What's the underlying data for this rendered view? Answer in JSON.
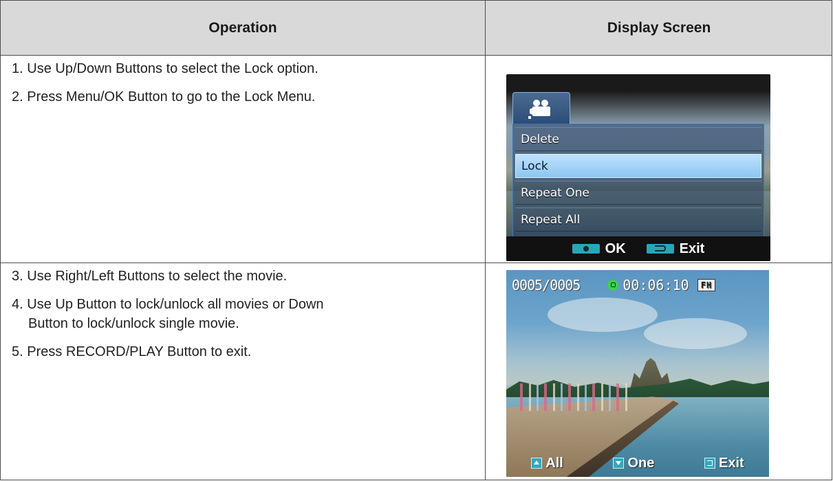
{
  "table": {
    "headers": {
      "operation": "Operation",
      "display": "Display Screen"
    },
    "rows": [
      {
        "steps": [
          {
            "num": "1.",
            "text": "Use Up/Down Buttons to select the Lock option."
          },
          {
            "num": "2.",
            "text": "Press Menu/OK Button to go to the Lock Menu."
          }
        ],
        "screen": {
          "type": "menu",
          "tab_icon": "movie-camera-icon",
          "items": [
            "Delete",
            "Lock",
            "Repeat One",
            "Repeat  All"
          ],
          "selected_index": 1,
          "footer": {
            "ok_label": "OK",
            "exit_label": "Exit"
          }
        }
      },
      {
        "steps": [
          {
            "num": "3.",
            "text": "Use Right/Left Buttons to select the movie."
          },
          {
            "num": "4.",
            "text": "Use Up Button to lock/unlock all movies or Down",
            "cont": "Button to lock/unlock single movie."
          },
          {
            "num": "5.",
            "text": "Press RECORD/PLAY Button to exit."
          }
        ],
        "screen": {
          "type": "playback",
          "counter": "0005/0005",
          "time": "00:06:10",
          "resolution_badge": "FH",
          "footer": {
            "all_label": "All",
            "one_label": "One",
            "exit_label": "Exit"
          }
        }
      }
    ]
  },
  "colors": {
    "header_bg": "#d9d9d9",
    "border": "#4d4d4d",
    "menu_selected": "#8cc6f1",
    "key_teal": "#27a6b5"
  }
}
